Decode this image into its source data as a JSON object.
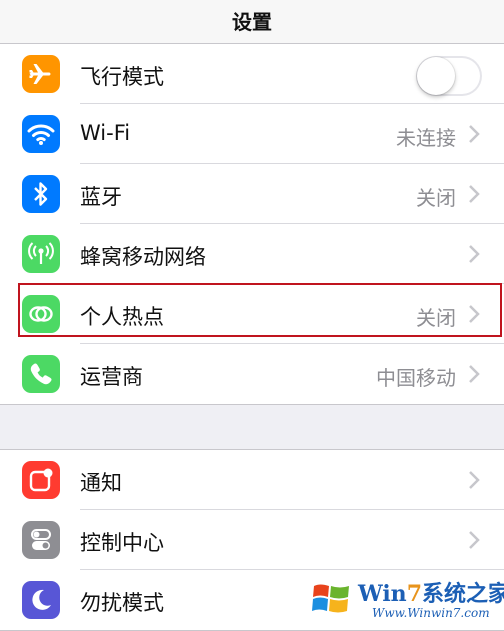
{
  "header": {
    "title": "设置"
  },
  "group1": {
    "rows": [
      {
        "label": "飞行模式",
        "icon": "airplane-icon",
        "color": "#ff9500",
        "toggle_on": false
      },
      {
        "label": "Wi-Fi",
        "value": "未连接",
        "icon": "wifi-icon",
        "color": "#007aff"
      },
      {
        "label": "蓝牙",
        "value": "关闭",
        "icon": "bluetooth-icon",
        "color": "#007aff"
      },
      {
        "label": "蜂窝移动网络",
        "icon": "cellular-icon",
        "color": "#4cd964"
      },
      {
        "label": "个人热点",
        "value": "关闭",
        "icon": "hotspot-icon",
        "color": "#4cd964"
      },
      {
        "label": "运营商",
        "value": "中国移动",
        "icon": "phone-icon",
        "color": "#4cd964"
      }
    ]
  },
  "group2": {
    "rows": [
      {
        "label": "通知",
        "icon": "notifications-icon",
        "color": "#ff3b30"
      },
      {
        "label": "控制中心",
        "icon": "control-center-icon",
        "color": "#8e8e93"
      },
      {
        "label": "勿扰模式",
        "icon": "moon-icon",
        "color": "#5856d6"
      }
    ]
  },
  "watermark": {
    "title_prefix": "Win",
    "title_num": "7",
    "title_suffix": "系统之家",
    "url": "Www.Winwin7.com"
  }
}
